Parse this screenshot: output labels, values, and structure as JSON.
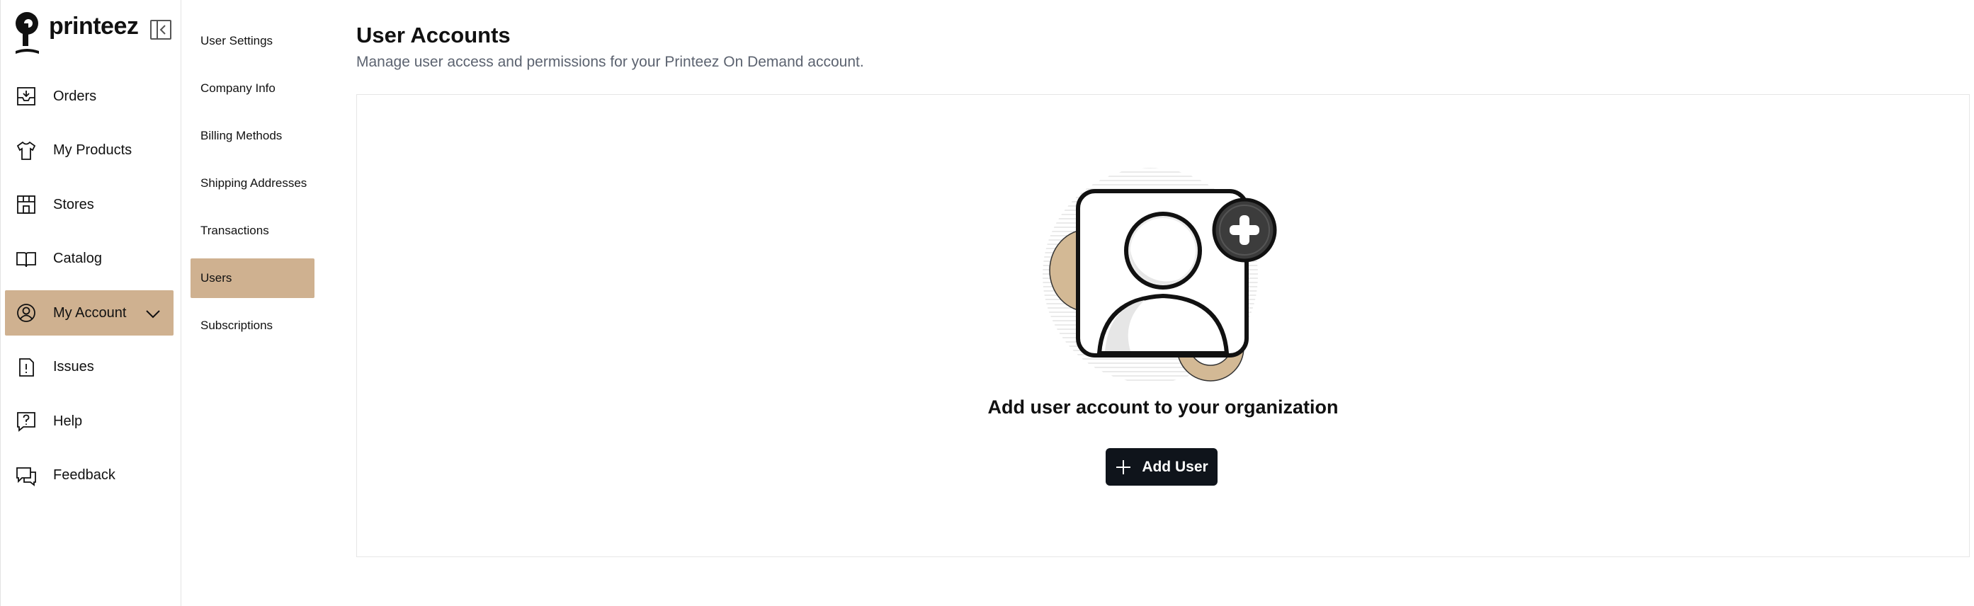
{
  "brand": {
    "name": "printeez",
    "logo_icon": "printeez-logo-icon",
    "accent_color": "#cfb190"
  },
  "sidebar": {
    "collapse_icon": "collapse-sidebar-icon",
    "items": [
      {
        "label": "Orders",
        "icon": "tray-download-icon"
      },
      {
        "label": "My Products",
        "icon": "tshirt-icon"
      },
      {
        "label": "Stores",
        "icon": "storefront-icon"
      },
      {
        "label": "Catalog",
        "icon": "open-book-icon"
      },
      {
        "label": "My Account",
        "icon": "user-circle-icon",
        "active": true,
        "expanded_icon": "chevron-down-icon"
      },
      {
        "label": "Issues",
        "icon": "alert-document-icon"
      },
      {
        "label": "Help",
        "icon": "question-chat-icon"
      },
      {
        "label": "Feedback",
        "icon": "chat-bubbles-icon"
      }
    ]
  },
  "subnav": {
    "items": [
      {
        "label": "User Settings"
      },
      {
        "label": "Company Info"
      },
      {
        "label": "Billing Methods"
      },
      {
        "label": "Shipping Addresses"
      },
      {
        "label": "Transactions"
      },
      {
        "label": "Users",
        "active": true
      },
      {
        "label": "Subscriptions"
      }
    ]
  },
  "main": {
    "title": "User Accounts",
    "subtitle": "Manage user access and permissions for your Printeez On Demand account.",
    "empty_state": {
      "illustration_icon": "add-user-illustration",
      "title": "Add user account to your organization",
      "button_label": "Add User",
      "button_icon": "plus-icon"
    }
  }
}
